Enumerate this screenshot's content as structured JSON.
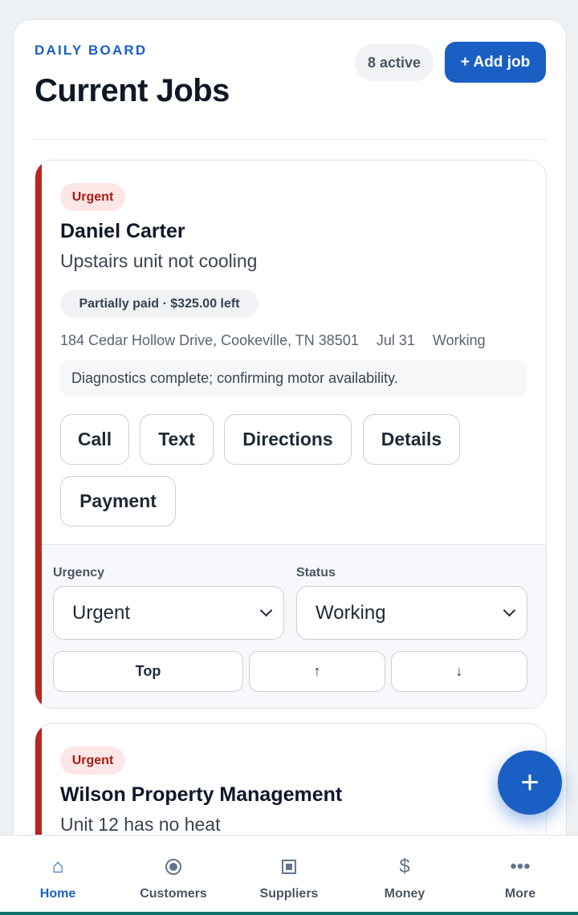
{
  "header": {
    "eyebrow": "DAILY BOARD",
    "title": "Current Jobs",
    "active_count": "8 active",
    "add_job_label": "+ Add job"
  },
  "jobs": [
    {
      "urgency_badge": "Urgent",
      "customer": "Daniel Carter",
      "issue": "Upstairs unit not cooling",
      "payment": "Partially paid · $325.00 left",
      "address": "184 Cedar Hollow Drive, Cookeville, TN 38501",
      "date": "Jul 31",
      "status_text": "Working",
      "note": "Diagnostics complete; confirming motor availability.",
      "actions": [
        "Call",
        "Text",
        "Directions",
        "Details",
        "Payment"
      ],
      "urgency_label": "Urgency",
      "urgency_value": "Urgent",
      "status_label": "Status",
      "status_value": "Working",
      "order_top": "Top",
      "order_up": "↑",
      "order_down": "↓"
    },
    {
      "urgency_badge": "Urgent",
      "customer": "Wilson Property Management",
      "issue": "Unit 12 has no heat"
    }
  ],
  "fab_label": "+",
  "nav": {
    "items": [
      {
        "label": "Home",
        "icon": "home-icon",
        "glyph": "⌂"
      },
      {
        "label": "Customers",
        "icon": "customers-icon",
        "glyph": ""
      },
      {
        "label": "Suppliers",
        "icon": "suppliers-icon",
        "glyph": ""
      },
      {
        "label": "Money",
        "icon": "dollar-icon",
        "glyph": "$"
      },
      {
        "label": "More",
        "icon": "more-icon",
        "glyph": "•••"
      }
    ]
  },
  "colors": {
    "primary": "#1a5fc4",
    "urgent_accent": "#b8261f",
    "urgent_badge_bg": "#fde7e6"
  }
}
